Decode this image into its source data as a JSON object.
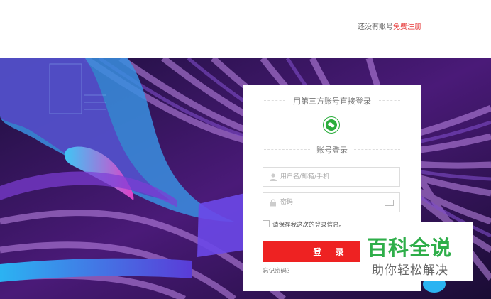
{
  "header": {
    "register_prompt": "还没有账号",
    "register_link": "免费注册"
  },
  "login": {
    "third_party_title": "用第三方账号直接登录",
    "wechat_icon": "wechat-icon",
    "account_title": "账号登录",
    "username_placeholder": "用户名/邮箱/手机",
    "password_placeholder": "密码",
    "remember_label": "请保存我这次的登录信息。",
    "login_button": "登 录",
    "forgot_password": "忘记密码？",
    "button_color": "#ee2222"
  },
  "watermark": {
    "title": "百科全说",
    "subtitle": "助你轻松解决"
  }
}
